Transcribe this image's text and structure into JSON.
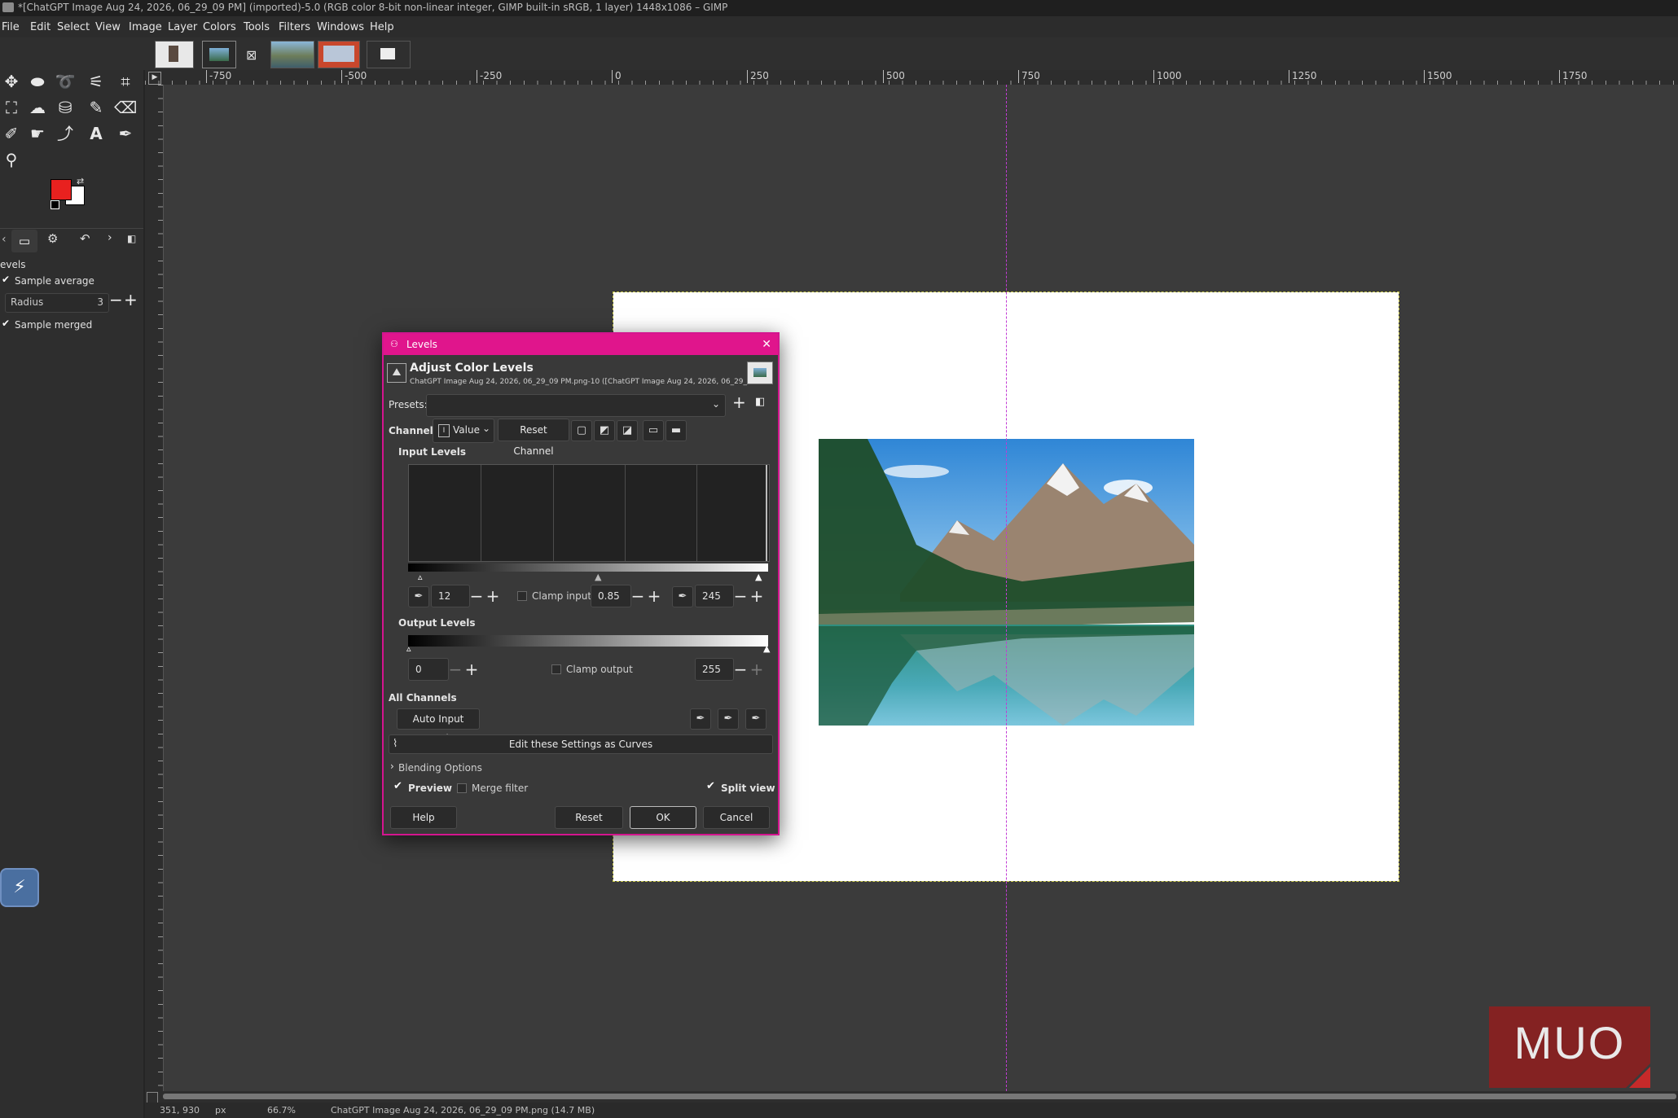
{
  "window": {
    "title": "*[ChatGPT Image Aug 24, 2026, 06_29_09 PM] (imported)-5.0 (RGB color 8-bit non-linear integer, GIMP built-in sRGB, 1 layer) 1448x1086 – GIMP"
  },
  "menu": [
    "File",
    "Edit",
    "Select",
    "View",
    "Image",
    "Layer",
    "Colors",
    "Tools",
    "Filters",
    "Windows",
    "Help"
  ],
  "ruler": {
    "h_labels": [
      "-750",
      "-500",
      "-250",
      "0",
      "250",
      "500",
      "750",
      "1000",
      "1250",
      "1500",
      "1750"
    ]
  },
  "tool_options": {
    "title": "evels",
    "sample_average": "Sample average",
    "radius_label": "Radius",
    "radius_value": "3",
    "sample_merged": "Sample merged"
  },
  "colors": {
    "foreground": "#e8211f",
    "background": "#ffffff",
    "dialog_accent": "#e0158c",
    "guide": "#c23bd4"
  },
  "dialog": {
    "title": "Levels",
    "heading": "Adjust Color Levels",
    "subheading": "ChatGPT Image Aug 24, 2026, 06_29_09 PM.png-10 ([ChatGPT Image Aug 24, 2026, 06_29_0...",
    "presets_label": "Presets:",
    "presets_value": "",
    "channel_label": "Channel:",
    "channel_value": "Value",
    "reset_channel": "Reset Channel",
    "input_levels": "Input Levels",
    "input_low": "12",
    "clamp_input": "Clamp input",
    "input_gamma": "0.85",
    "input_high": "245",
    "output_levels": "Output Levels",
    "output_low": "0",
    "clamp_output": "Clamp output",
    "output_high": "255",
    "all_channels": "All Channels",
    "auto_input": "Auto Input Levels",
    "edit_as_curves": "Edit these Settings as Curves",
    "blending_options": "Blending Options",
    "preview": "Preview",
    "merge_filter": "Merge filter",
    "split_view": "Split view",
    "help": "Help",
    "reset": "Reset",
    "ok": "OK",
    "cancel": "Cancel"
  },
  "status": {
    "coords": "351, 930",
    "unit": "px",
    "zoom": "66.7%",
    "info": "ChatGPT Image Aug 24, 2026, 06_29_09 PM.png (14.7 MB)"
  },
  "watermark": "MUO"
}
